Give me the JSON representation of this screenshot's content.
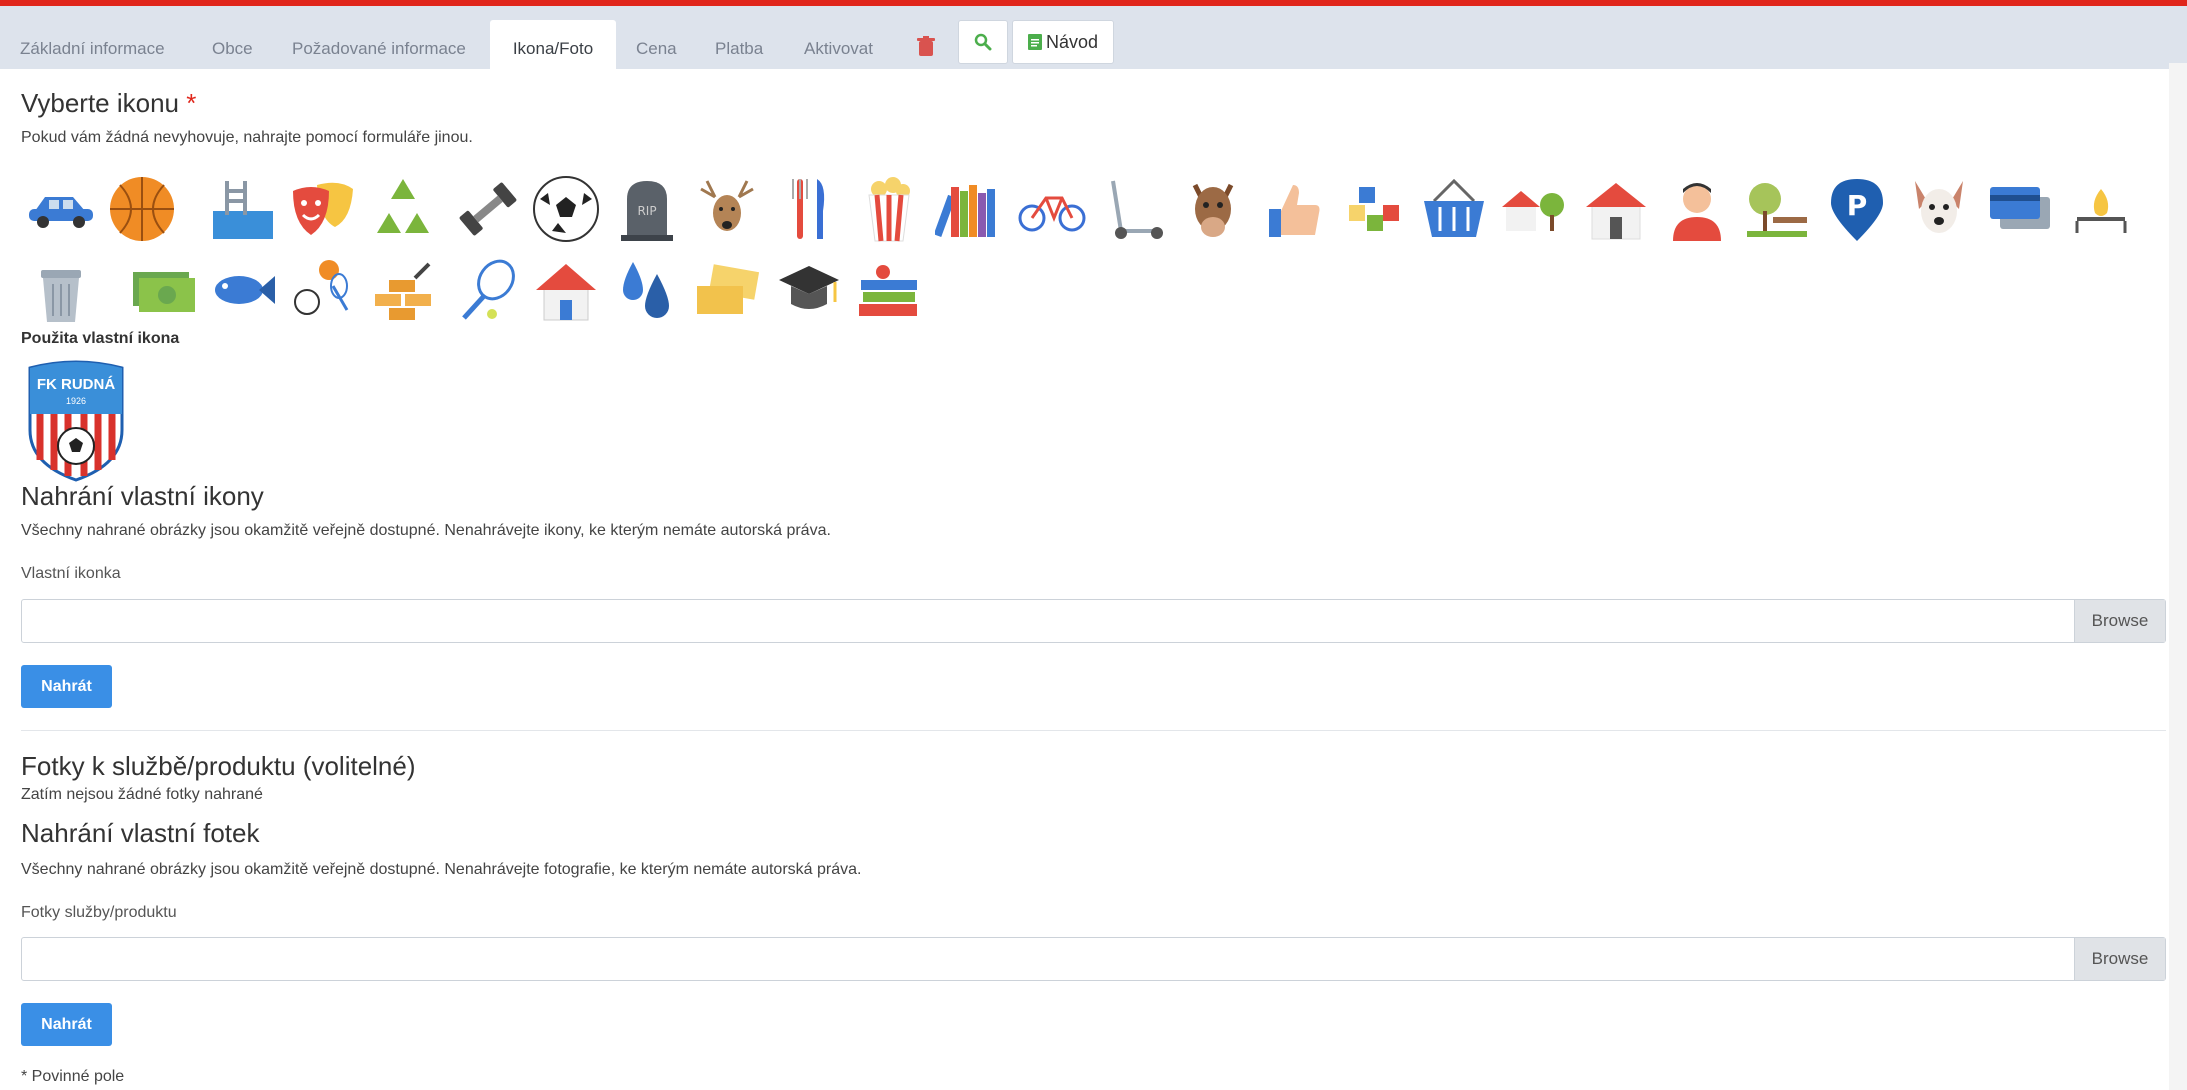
{
  "tabs": [
    {
      "label": "Základní informace"
    },
    {
      "label": "Obce"
    },
    {
      "label": "Požadované informace"
    },
    {
      "label": "Ikona/Foto"
    },
    {
      "label": "Cena"
    },
    {
      "label": "Platba"
    },
    {
      "label": "Aktivovat"
    }
  ],
  "toolbar": {
    "guide_label": "Návod"
  },
  "icons_section": {
    "title": "Vyberte ikonu",
    "required_mark": "*",
    "hint": "Pokud vám žádná nevyhovuje, nahrajte pomocí formuláře jinou.",
    "icons": [
      "car-icon",
      "basketball-icon",
      "swimming-pool-icon",
      "theater-masks-icon",
      "recycle-icon",
      "dumbbell-icon",
      "soccer-ball-icon",
      "tombstone-icon",
      "deer-icon",
      "cutlery-icon",
      "popcorn-icon",
      "books-icon",
      "bicycle-icon",
      "scooter-icon",
      "horse-icon",
      "thumbs-up-icon",
      "abc-blocks-icon",
      "basket-icon",
      "houses-icon",
      "house-icon",
      "person-icon",
      "park-bench-icon",
      "parking-icon",
      "dog-icon",
      "credit-card-icon",
      "gas-burner-icon",
      "trash-bin-icon",
      "money-icon",
      "fish-icon",
      "sports-balls-icon",
      "bricks-icon",
      "tennis-racket-icon",
      "home-icon",
      "water-drops-icon",
      "tickets-icon",
      "graduation-cap-icon",
      "school-books-icon"
    ],
    "custom_icon_label": "Použita vlastní ikona",
    "custom_logo_text": "FK RUDNÁ",
    "custom_logo_year": "1926"
  },
  "upload_icon": {
    "title": "Nahrání vlastní ikony",
    "note": "Všechny nahrané obrázky jsou okamžitě veřejně dostupné. Nenahrávejte ikony, ke kterým nemáte autorská práva.",
    "field_label": "Vlastní ikonka",
    "browse_label": "Browse",
    "submit_label": "Nahrát"
  },
  "photos": {
    "title": "Fotky k službě/produktu (volitelné)",
    "empty_text": "Zatím nejsou žádné fotky nahrané"
  },
  "upload_photos": {
    "title": "Nahrání vlastní fotek",
    "note": "Všechny nahrané obrázky jsou okamžitě veřejně dostupné. Nenahrávejte fotografie, ke kterým nemáte autorská práva.",
    "field_label": "Fotky služby/produktu",
    "browse_label": "Browse",
    "submit_label": "Nahrát"
  },
  "footer": {
    "required_note": "* Povinné pole"
  },
  "colors": {
    "accent": "#e0261b",
    "primary": "#3a8fe6",
    "tabbar": "#dde3ec"
  }
}
